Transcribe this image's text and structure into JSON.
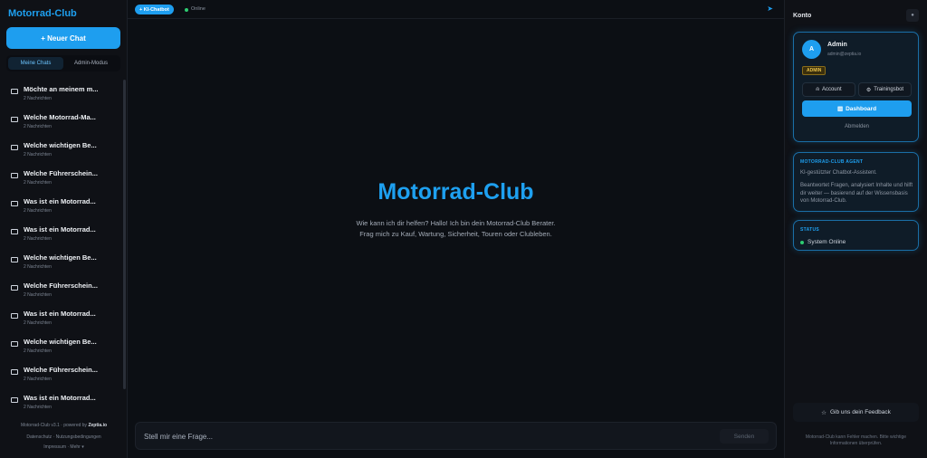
{
  "sidebar": {
    "brand": "Motorrad-Club",
    "new_chat_label": "+ Neuer Chat",
    "tabs": [
      {
        "label": "Meine Chats",
        "active": true
      },
      {
        "label": "Admin-Modus",
        "active": false
      }
    ],
    "chats": [
      {
        "title": "Möchte an meinem m...",
        "sub": "2 Nachrichten"
      },
      {
        "title": "Welche Motorrad-Ma...",
        "sub": "2 Nachrichten"
      },
      {
        "title": "Welche wichtigen Be...",
        "sub": "2 Nachrichten"
      },
      {
        "title": "Welche Führerschein...",
        "sub": "2 Nachrichten"
      },
      {
        "title": "Was ist ein Motorrad...",
        "sub": "2 Nachrichten"
      },
      {
        "title": "Was ist ein Motorrad...",
        "sub": "2 Nachrichten"
      },
      {
        "title": "Welche wichtigen Be...",
        "sub": "2 Nachrichten"
      },
      {
        "title": "Welche Führerschein...",
        "sub": "2 Nachrichten"
      },
      {
        "title": "Was ist ein Motorrad...",
        "sub": "2 Nachrichten"
      },
      {
        "title": "Welche wichtigen Be...",
        "sub": "2 Nachrichten"
      },
      {
        "title": "Welche Führerschein...",
        "sub": "2 Nachrichten"
      },
      {
        "title": "Was ist ein Motorrad...",
        "sub": "2 Nachrichten"
      }
    ],
    "footer": {
      "version": "Motorrad-Club v3.1 · powered by",
      "powered_brand": "Zeptia.io",
      "links_row1": "Datenschutz  ·  Nutzungsbedingungen",
      "links_row2": "Impressum  ·  Mehr ▾"
    }
  },
  "main": {
    "badge": "+ KI-Chatbot",
    "status": "Online",
    "send_icon": "paper-plane-icon",
    "hero_title": "Motorrad-Club",
    "hero_line1": "Wie kann ich dir helfen? Hallo! Ich bin dein Motorrad-Club Berater.",
    "hero_line2": "Frag mich zu Kauf, Wartung, Sicherheit, Touren oder Clubleben.",
    "input_placeholder": "Stell mir eine Frage...",
    "send_label": "Senden"
  },
  "panel": {
    "title": "Konto",
    "user": {
      "initial": "A",
      "name": "Admin",
      "email": "admin@zeptia.io",
      "role": "ADMIN"
    },
    "account_label": "Account",
    "trainingsbot_label": "Trainingsbot",
    "dashboard_label": "Dashboard",
    "logout_label": "Abmelden",
    "agent": {
      "heading": "MOTORRAD-CLUB AGENT",
      "line1": "KI-gestützter Chatbot-Assistent.",
      "line2": "Beantwortet Fragen, analysiert Inhalte und hilft dir weiter — basierend auf der Wissensbasis von Motorrad-Club."
    },
    "status": {
      "heading": "STATUS",
      "text": "System Online"
    },
    "feedback_label": "Gib uns dein Feedback",
    "disclaimer": "Motorrad-Club kann Fehler machen. Bitte wichtige Informationen überprüfen."
  },
  "colors": {
    "accent": "#1e9eef",
    "background": "#0a0c10",
    "online": "#2ecc71",
    "admin_badge": "#e8c14a"
  }
}
